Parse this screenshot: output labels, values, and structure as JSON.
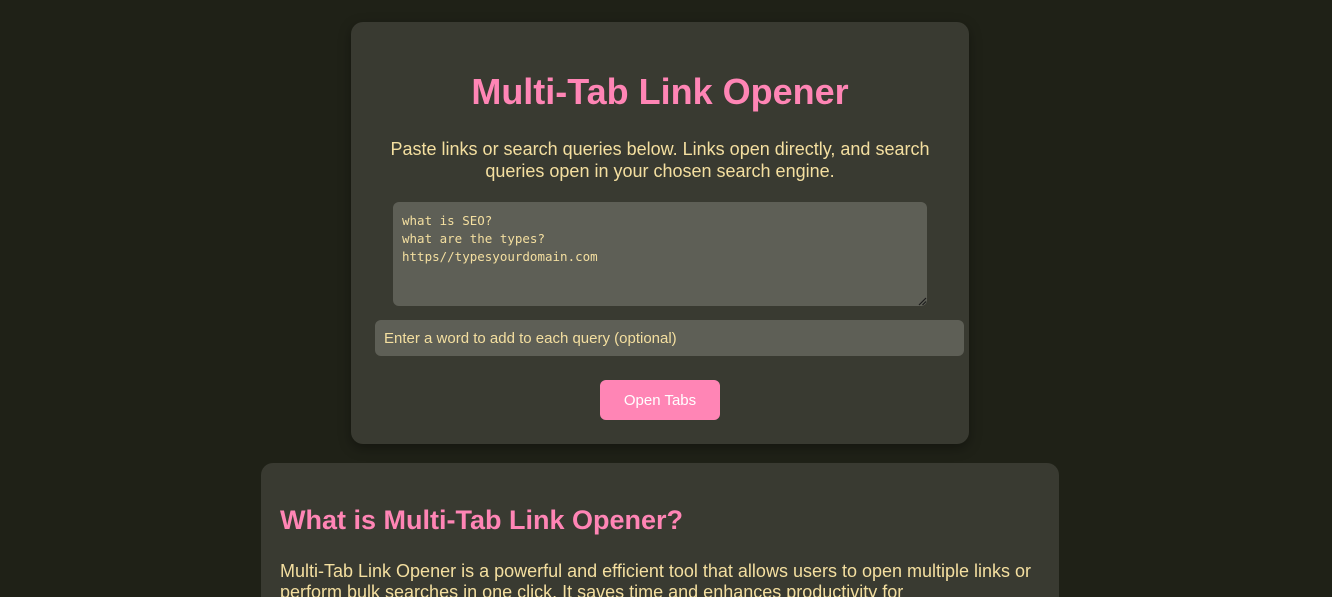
{
  "tool": {
    "title": "Multi-Tab Link Opener",
    "description": "Paste links or search queries below. Links open directly, and search queries open in your chosen search engine.",
    "textarea_value": "what is SEO?\nwhat are the types?\nhttps//typesyourdomain.com",
    "word_input_placeholder": "Enter a word to add to each query (optional)",
    "open_button_label": "Open Tabs"
  },
  "info": {
    "heading": "What is Multi-Tab Link Opener?",
    "paragraph": "Multi-Tab Link Opener is a powerful and efficient tool that allows users to open multiple links or perform bulk searches in one click. It saves time and enhances productivity for"
  },
  "colors": {
    "page_background": "#1f2117",
    "card_background": "#393a31",
    "accent_pink": "#ff85b5",
    "text_yellow": "#f4dfa0",
    "field_background": "#5e5f56"
  },
  "icons": {
    "resize_handle": "resize-grip-icon"
  }
}
